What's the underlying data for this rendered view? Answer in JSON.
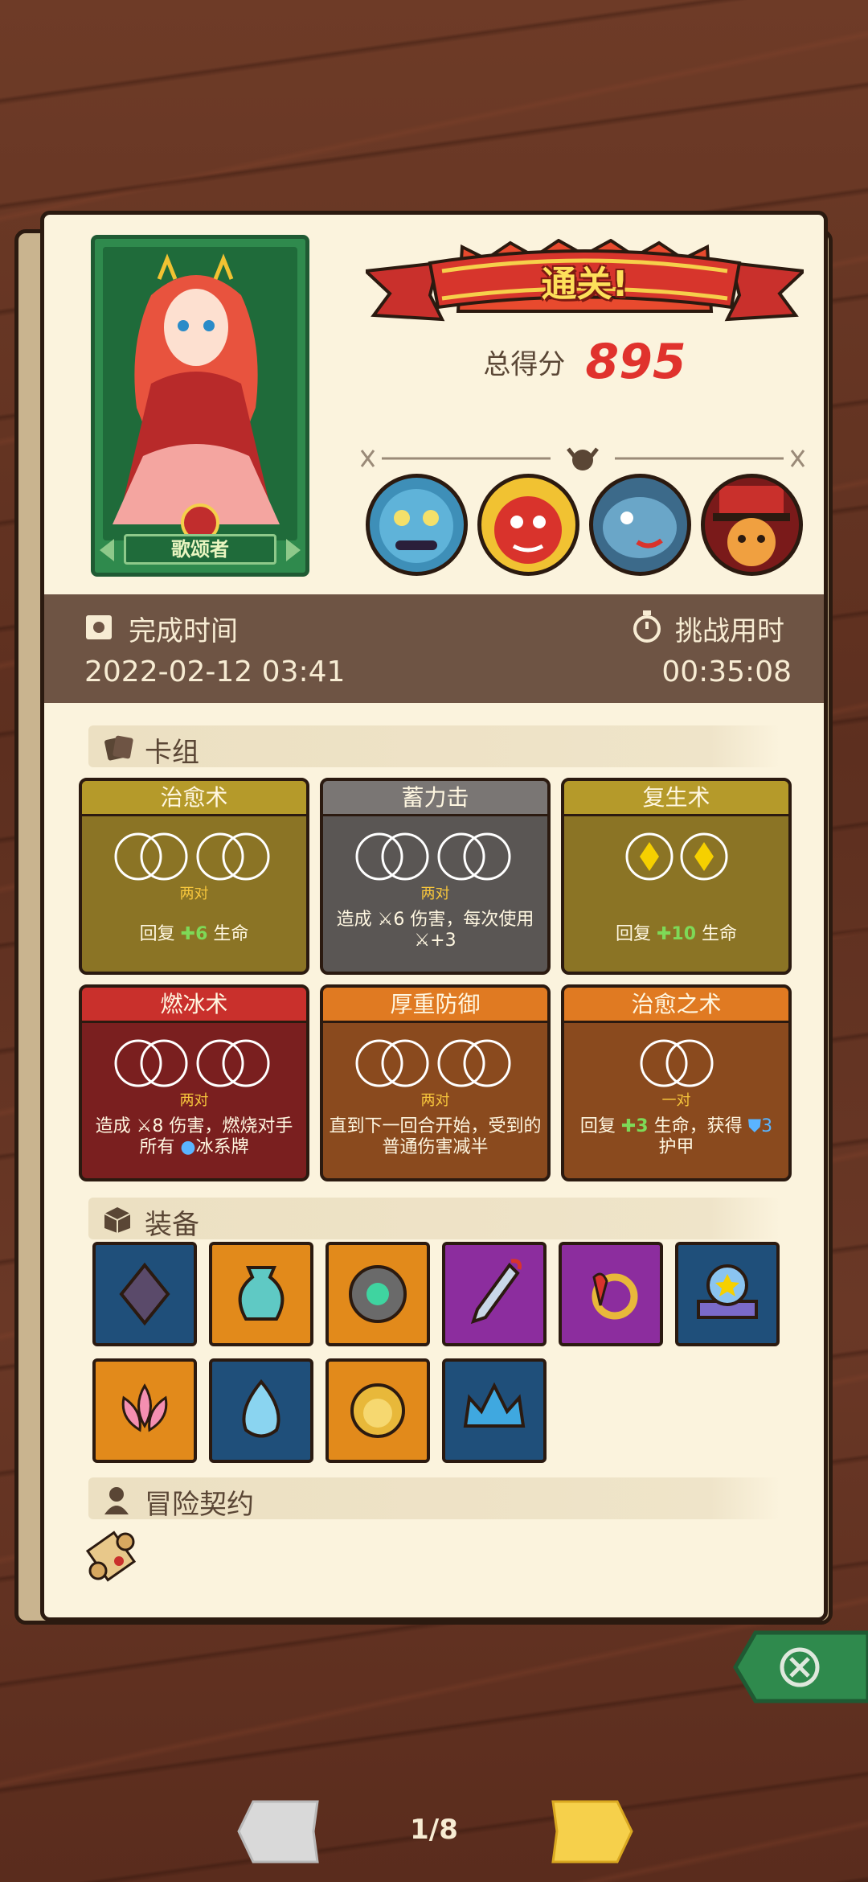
{
  "hero": {
    "name": "歌颂者"
  },
  "result": {
    "banner": "通关!",
    "score_label": "总得分",
    "score_value": "895"
  },
  "bosses": [
    {
      "icon": "blue-toad-boss-icon"
    },
    {
      "icon": "red-demon-boss-icon"
    },
    {
      "icon": "blue-fish-boss-icon"
    },
    {
      "icon": "red-hat-boss-icon"
    }
  ],
  "time": {
    "completion_label": "完成时间",
    "completion_value": "2022-02-12 03:41",
    "challenge_label": "挑战用时",
    "challenge_value": "00:35:08"
  },
  "sections": {
    "deck": "卡组",
    "equipment": "装备",
    "contract": "冒险契约"
  },
  "cards": [
    {
      "title": "治愈术",
      "sub": "两对",
      "desc_a": "回复",
      "desc_hl": "6",
      "desc_b": "生命",
      "color": "#8b7425"
    },
    {
      "title": "蓄力击",
      "sub": "两对",
      "desc_a": "造成",
      "desc_hl": "6",
      "desc_b": "伤害，每次使用",
      "desc_c": "+3",
      "color": "#5a5654"
    },
    {
      "title": "复生术",
      "sub": "",
      "desc_a": "回复",
      "desc_hl": "10",
      "desc_b": "生命",
      "color": "#8b7425"
    },
    {
      "title": "燃冰术",
      "sub": "两对",
      "desc_a": "造成",
      "desc_hl": "8",
      "desc_b": "伤害，燃烧对手",
      "desc_c": "所有",
      "desc_d": "冰系牌",
      "color": "#7a1f1f"
    },
    {
      "title": "厚重防御",
      "sub": "两对",
      "desc_a": "直到下一回合开始，受到的",
      "desc_b": "普通伤害减半",
      "color": "#8a4a1e"
    },
    {
      "title": "治愈之术",
      "sub": "一对",
      "desc_a": "回复",
      "desc_hl": "3",
      "desc_b": "生命，获得",
      "desc_hl2": "3",
      "desc_c": "护甲",
      "color": "#8a4a1e"
    }
  ],
  "equipment": [
    {
      "icon": "dark-gem-icon",
      "bg": "#1f4f7a"
    },
    {
      "icon": "vase-icon",
      "bg": "#e28a1b"
    },
    {
      "icon": "spiked-orb-icon",
      "bg": "#e28a1b"
    },
    {
      "icon": "dagger-icon",
      "bg": "#8c2d9e"
    },
    {
      "icon": "ruby-ring-icon",
      "bg": "#8c2d9e"
    },
    {
      "icon": "star-crystal-icon",
      "bg": "#1f4f7a"
    },
    {
      "icon": "lotus-icon",
      "bg": "#e28a1b"
    },
    {
      "icon": "diamond-icon",
      "bg": "#1f4f7a"
    },
    {
      "icon": "lion-ring-icon",
      "bg": "#e28a1b"
    },
    {
      "icon": "crown-icon",
      "bg": "#1f4f7a"
    }
  ],
  "pagination": {
    "text": "1/8"
  }
}
